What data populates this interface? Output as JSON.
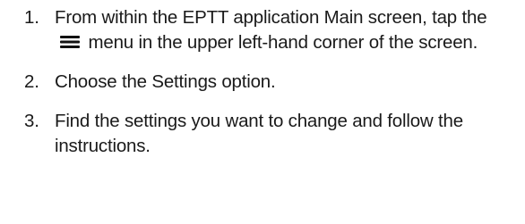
{
  "steps": [
    {
      "number": "1.",
      "text_before": "From within the EPTT application Main screen, tap the",
      "icon": "hamburger-menu-icon",
      "text_after": "menu in the upper left-hand corner of the screen."
    },
    {
      "number": "2.",
      "text_before": "Choose the",
      "emphasis": "Settings",
      "text_after": "option."
    },
    {
      "number": "3.",
      "text": "Find the settings you want to change and follow the instructions."
    }
  ]
}
